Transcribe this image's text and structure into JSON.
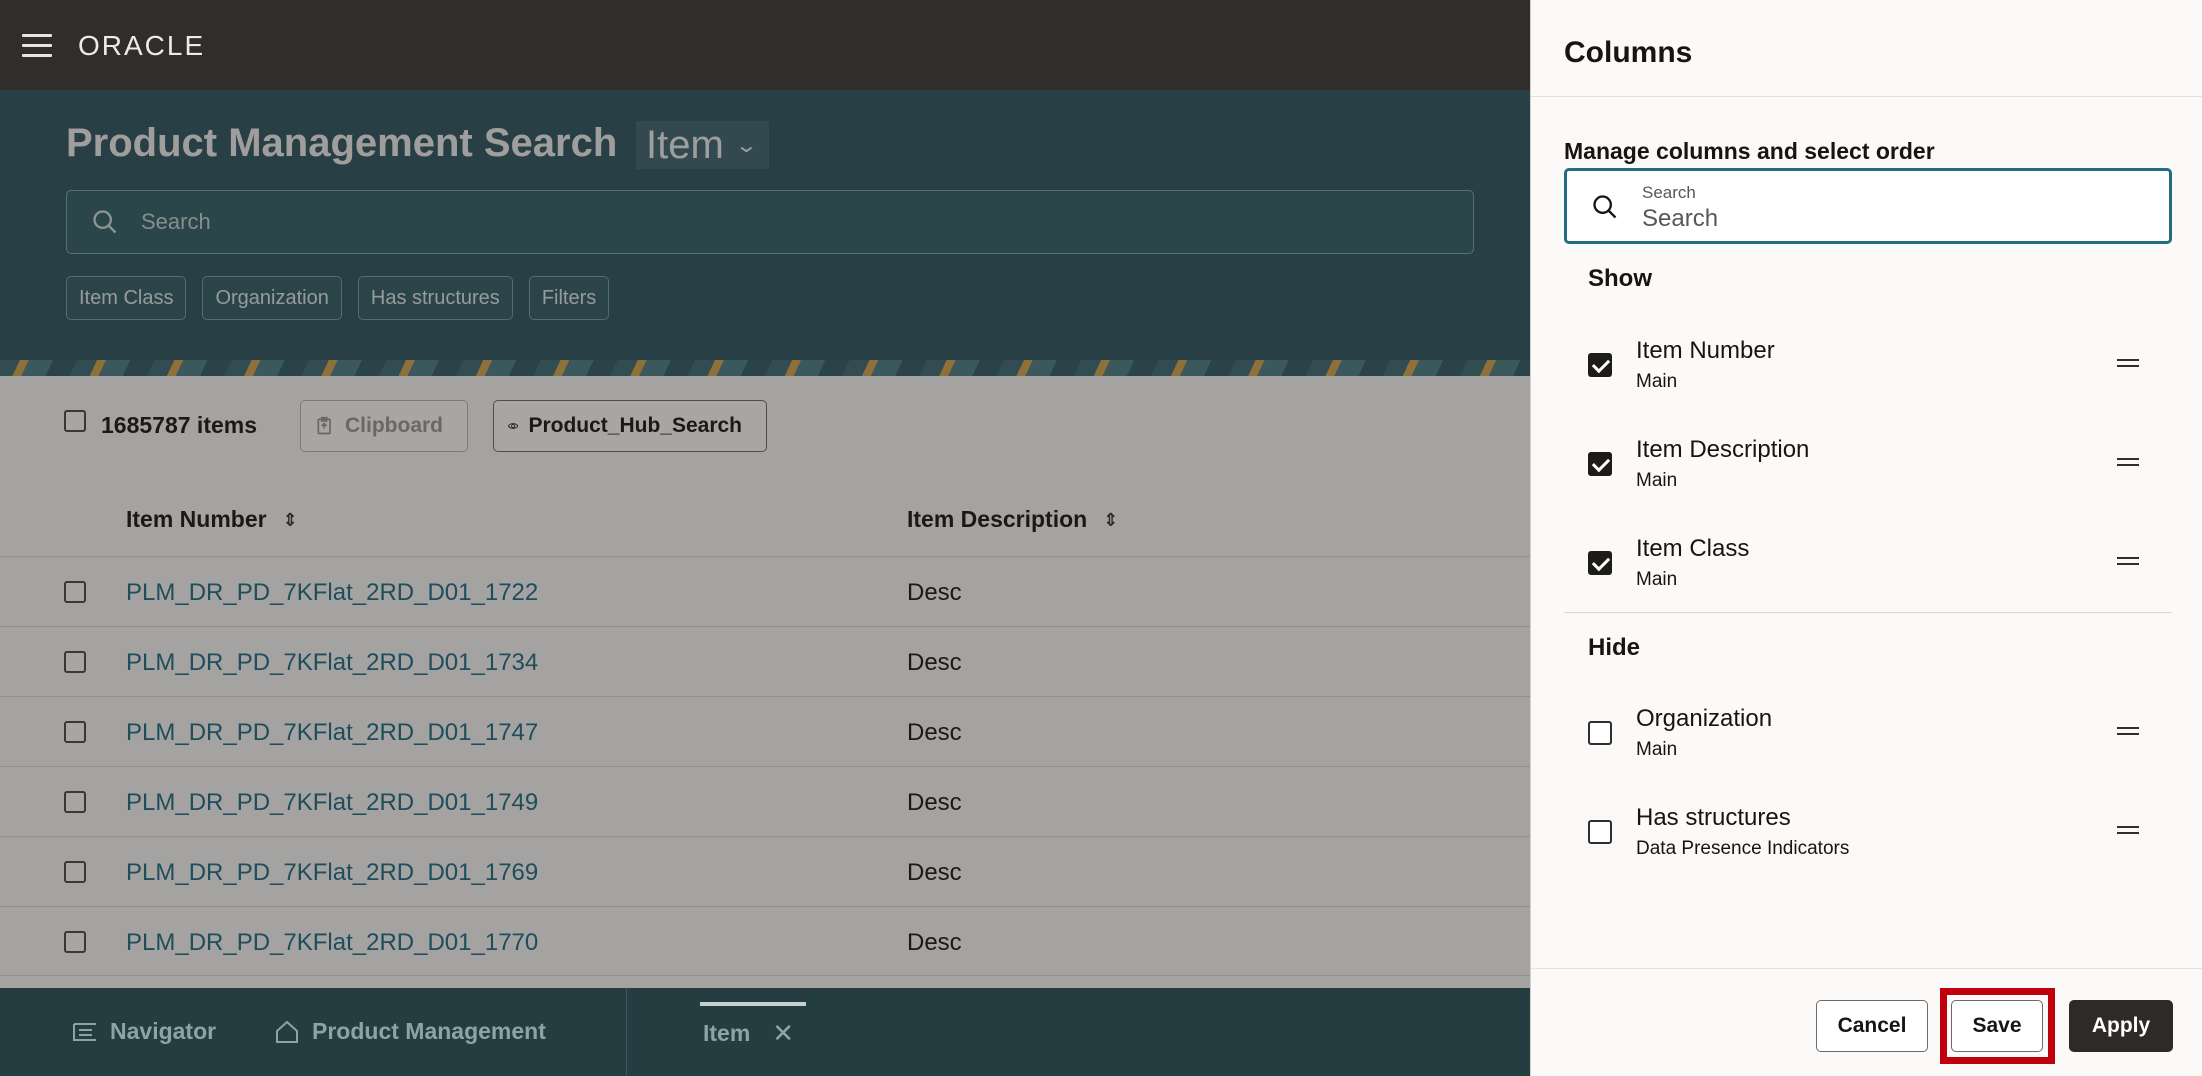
{
  "topbar": {
    "logo": "ORACLE"
  },
  "header": {
    "title": "Product Management Search",
    "scope": "Item",
    "search_placeholder": "Search",
    "chips": [
      "Item Class",
      "Organization",
      "Has structures",
      "Filters"
    ]
  },
  "results": {
    "count_label": "1685787 items",
    "clipboard_label": "Clipboard",
    "saved_search_label": "Product_Hub_Search",
    "columns": [
      "Item Number",
      "Item Description"
    ],
    "rows": [
      {
        "number": "PLM_DR_PD_7KFlat_2RD_D01_1722",
        "description": "Desc"
      },
      {
        "number": "PLM_DR_PD_7KFlat_2RD_D01_1734",
        "description": "Desc"
      },
      {
        "number": "PLM_DR_PD_7KFlat_2RD_D01_1747",
        "description": "Desc"
      },
      {
        "number": "PLM_DR_PD_7KFlat_2RD_D01_1749",
        "description": "Desc"
      },
      {
        "number": "PLM_DR_PD_7KFlat_2RD_D01_1769",
        "description": "Desc"
      },
      {
        "number": "PLM_DR_PD_7KFlat_2RD_D01_1770",
        "description": "Desc"
      }
    ]
  },
  "bottom_nav": {
    "navigator": "Navigator",
    "product_management": "Product Management",
    "active_tab": "Item"
  },
  "panel": {
    "title": "Columns",
    "subtitle": "Manage columns and select order",
    "search_label": "Search",
    "search_placeholder": "Search",
    "show_heading": "Show",
    "hide_heading": "Hide",
    "show_items": [
      {
        "name": "Item Number",
        "group": "Main",
        "checked": true
      },
      {
        "name": "Item Description",
        "group": "Main",
        "checked": true
      },
      {
        "name": "Item Class",
        "group": "Main",
        "checked": true
      }
    ],
    "hide_items": [
      {
        "name": "Organization",
        "group": "Main",
        "checked": false
      },
      {
        "name": "Has structures",
        "group": "Data Presence Indicators",
        "checked": false
      }
    ],
    "cancel_label": "Cancel",
    "save_label": "Save",
    "apply_label": "Apply"
  },
  "colors": {
    "topbar": "#312d2a",
    "header": "#2a5460",
    "link": "#1b6b86",
    "primary_button": "#2d2a27",
    "highlight": "#c0000c"
  }
}
